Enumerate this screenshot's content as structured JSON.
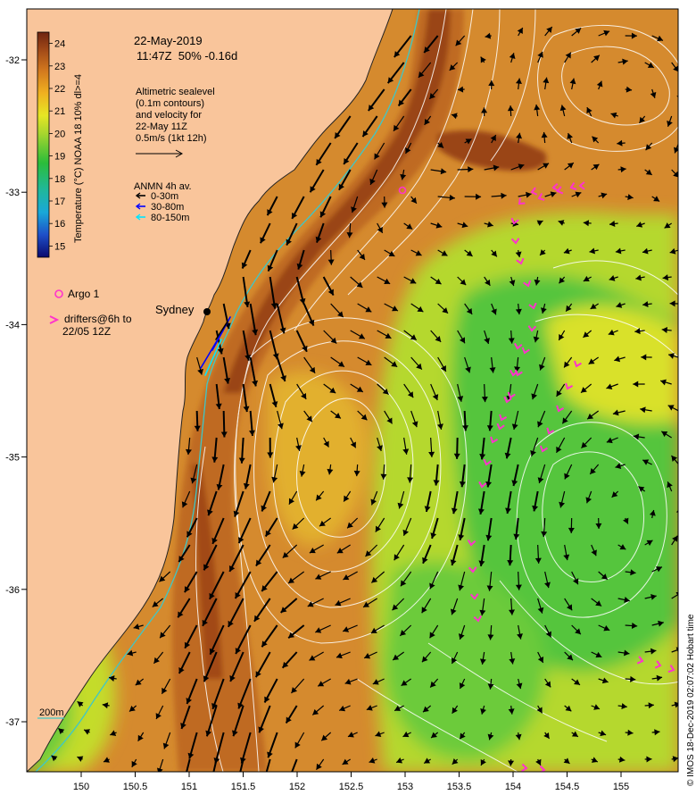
{
  "date": "22-May-2019",
  "time_line": "11:47Z  50% -0.16d",
  "colorbar": {
    "label": "Temperature (°C) NOAA 18 10% dl>=4",
    "ticks": [
      "24",
      "23",
      "22",
      "21",
      "20",
      "19",
      "18",
      "17",
      "16",
      "15"
    ],
    "min": 14.5,
    "max": 24.5
  },
  "altimetry": {
    "lines": [
      "Altimetric sealevel",
      "(0.1m contours)",
      "and velocity for",
      "22-May 11Z",
      "0.5m/s (1kt 12h)"
    ]
  },
  "anmn": {
    "title": "ANMN 4h av.",
    "items": [
      {
        "label": "0-30m",
        "color": "#000000"
      },
      {
        "label": "30-80m",
        "color": "#0000ff"
      },
      {
        "label": "80-150m",
        "color": "#00e5ff"
      }
    ]
  },
  "argo_label": "Argo 1",
  "drifters": {
    "line1": "drifters@6h to",
    "line2": "22/05 12Z"
  },
  "place_sydney": "Sydney",
  "isobath_label": "200m",
  "x_ticks": [
    "150",
    "150.5",
    "151",
    "151.5",
    "152",
    "152.5",
    "153",
    "153.5",
    "154",
    "154.5",
    "155"
  ],
  "y_ticks": [
    "-32",
    "-33",
    "-34",
    "-35",
    "-36",
    "-37"
  ],
  "credit": "© IMOS 18-Dec-2019 02:07:02 Hobart time",
  "colors": {
    "land": "#f9c59b",
    "warm": "#c8752a",
    "core": "#8f3a19",
    "mid": "#e29a3a",
    "cool": "#a8d62e",
    "cooler": "#4fc43c",
    "contour": "#ffffff",
    "drifter": "#ff33cc",
    "argo": "#ff33cc",
    "isobath": "#3ec7c7"
  }
}
